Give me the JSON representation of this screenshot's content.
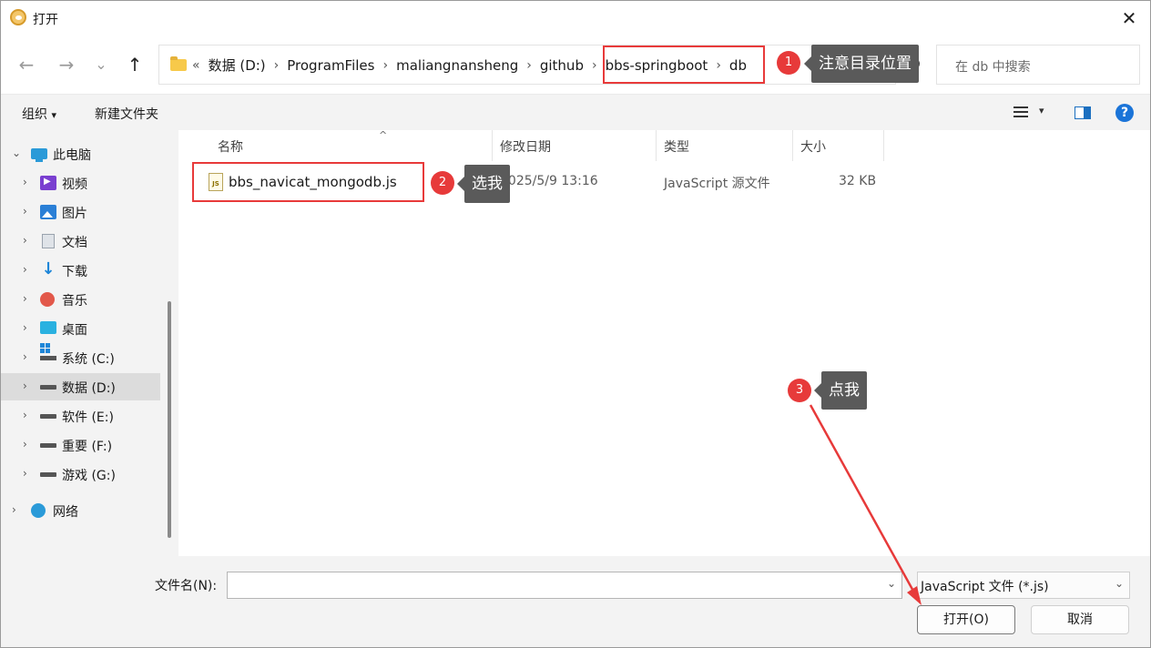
{
  "window": {
    "title": "打开",
    "close": "✕"
  },
  "nav": {
    "back": "←",
    "forward": "→",
    "recent": "⌄",
    "up": "↑",
    "overflow": "«",
    "crumbs": [
      "数据 (D:)",
      "ProgramFiles",
      "maliangnansheng",
      "github",
      "bbs-springboot",
      "db"
    ],
    "sep": "›",
    "search_placeholder": "在 db 中搜索"
  },
  "toolbar": {
    "organize": "组织",
    "organize_caret": "▾",
    "new_folder": "新建文件夹",
    "view_caret": "▾",
    "help": "?"
  },
  "sidebar": {
    "items": [
      {
        "label": "此电脑",
        "icon": "computer-icon"
      },
      {
        "label": "视频",
        "icon": "video-icon"
      },
      {
        "label": "图片",
        "icon": "pictures-icon"
      },
      {
        "label": "文档",
        "icon": "documents-icon"
      },
      {
        "label": "下载",
        "icon": "downloads-icon"
      },
      {
        "label": "音乐",
        "icon": "music-icon"
      },
      {
        "label": "桌面",
        "icon": "desktop-icon"
      },
      {
        "label": "系统 (C:)",
        "icon": "drive-icon"
      },
      {
        "label": "数据 (D:)",
        "icon": "drive-icon"
      },
      {
        "label": "软件 (E:)",
        "icon": "drive-icon"
      },
      {
        "label": "重要 (F:)",
        "icon": "drive-icon"
      },
      {
        "label": "游戏 (G:)",
        "icon": "drive-icon"
      },
      {
        "label": "网络",
        "icon": "network-icon"
      }
    ],
    "expanded_chevron": "⌄",
    "collapsed_chevron": "›"
  },
  "columns": {
    "name": "名称",
    "modified": "修改日期",
    "type": "类型",
    "size": "大小",
    "sort_caret": "^"
  },
  "files": [
    {
      "name": "bbs_navicat_mongodb.js",
      "modified": "2025/5/9 13:16",
      "type": "JavaScript 源文件",
      "size": "32 KB",
      "icon_text": "JS"
    }
  ],
  "bottom": {
    "filename_label": "文件名(N):",
    "filename_value": "",
    "filetype": "JavaScript 文件 (*.js)",
    "caret": "⌄",
    "open": "打开(O)",
    "cancel": "取消"
  },
  "annotations": {
    "badge1": "1",
    "callout1": "注意目录位置",
    "badge2": "2",
    "callout2": "选我",
    "badge3": "3",
    "callout3": "点我",
    "color": "#e73a3a"
  }
}
